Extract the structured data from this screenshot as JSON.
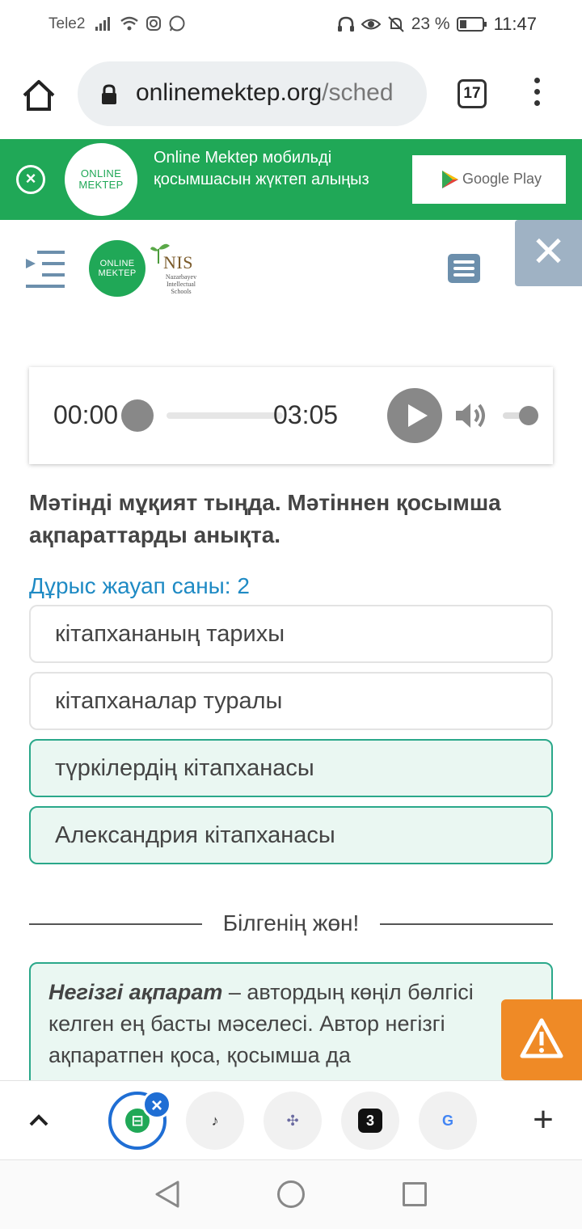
{
  "status_bar": {
    "carrier": "Tele2",
    "battery_percent": "23 %",
    "time": "11:47"
  },
  "browser": {
    "url_domain": "onlinemektep.org",
    "url_path": "/sched",
    "tab_count": "17"
  },
  "banner": {
    "logo_line1": "ONLINE",
    "logo_line2": "MEKTEP",
    "message": "Online Mektep мобильді қосымшасын жүктеп алыңыз",
    "store_button": "Google Play"
  },
  "header": {
    "logo_line1": "ONLINE",
    "logo_line2": "MEKTEP",
    "nis_title": "NIS",
    "nis_subtitle": "Nazarbayev Intellectual Schools",
    "close_label": "✕"
  },
  "player": {
    "current_time": "00:00",
    "total_time": "03:05",
    "progress": 0,
    "volume": 1
  },
  "task": {
    "question": "Мәтінді мұқият тыңда. Мәтіннен қосымша ақпараттарды анықта.",
    "answer_count": "Дұрыс жауап саны: 2",
    "options": [
      {
        "label": "кітапхананың тарихы",
        "selected": false
      },
      {
        "label": "кітапханалар туралы",
        "selected": false
      },
      {
        "label": "түркілердің кітапханасы",
        "selected": true
      },
      {
        "label": "Александрия кітапханасы",
        "selected": true
      }
    ]
  },
  "tip": {
    "divider_label": "Білгенің жөн!",
    "term": "Негізгі ақпарат",
    "text": " – автордың көңіл бөлгісі келген ең басты мәселесі. Автор негізгі ақпаратпен қоса, қосымша да"
  },
  "tabstrip": {
    "tabs": [
      {
        "icon": "onlinemektep-favicon",
        "glyph": "⊟",
        "color": "#20a857",
        "active": true
      },
      {
        "icon": "music-notes-favicon",
        "glyph": "♪",
        "color": "#333333",
        "active": false
      },
      {
        "icon": "pinwheel-favicon",
        "glyph": "✣",
        "color": "#6a6aa0",
        "active": false
      },
      {
        "icon": "number-3-favicon",
        "glyph": "3",
        "color": "#111111",
        "active": false
      },
      {
        "icon": "google-favicon",
        "glyph": "G",
        "color": "#4285f4",
        "active": false
      }
    ],
    "close_label": "×",
    "new_tab_label": "+"
  }
}
